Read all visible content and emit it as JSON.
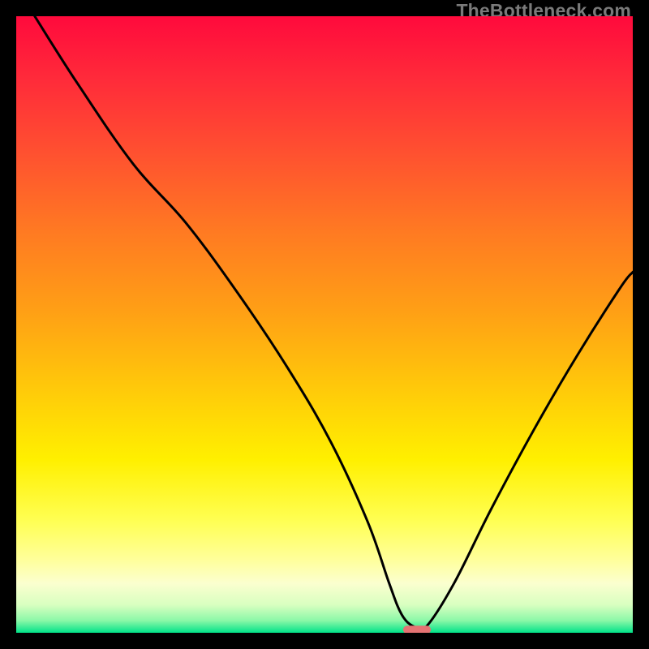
{
  "watermark": "TheBottleneck.com",
  "chart_data": {
    "type": "line",
    "title": "",
    "xlabel": "",
    "ylabel": "",
    "xlim": [
      0,
      100
    ],
    "ylim": [
      0,
      100
    ],
    "grid": false,
    "legend": false,
    "gradient_stops": [
      {
        "pos": 0.0,
        "color": "#ff0a3c"
      },
      {
        "pos": 0.1,
        "color": "#ff2a3a"
      },
      {
        "pos": 0.22,
        "color": "#ff5030"
      },
      {
        "pos": 0.35,
        "color": "#ff7a22"
      },
      {
        "pos": 0.48,
        "color": "#ffa015"
      },
      {
        "pos": 0.6,
        "color": "#ffc80a"
      },
      {
        "pos": 0.72,
        "color": "#fff000"
      },
      {
        "pos": 0.82,
        "color": "#ffff55"
      },
      {
        "pos": 0.88,
        "color": "#ffff99"
      },
      {
        "pos": 0.92,
        "color": "#fbffcf"
      },
      {
        "pos": 0.955,
        "color": "#d8ffc0"
      },
      {
        "pos": 0.98,
        "color": "#8cf8a8"
      },
      {
        "pos": 1.0,
        "color": "#00e288"
      }
    ],
    "series": [
      {
        "name": "bottleneck-curve",
        "x": [
          3.0,
          10.0,
          19.0,
          27.5,
          36.0,
          44.0,
          51.0,
          57.0,
          60.5,
          62.5,
          64.5,
          66.5,
          71.0,
          77.0,
          84.0,
          91.0,
          98.0,
          100.0
        ],
        "y": [
          100.0,
          89.0,
          76.0,
          66.5,
          55.0,
          43.0,
          31.0,
          18.0,
          8.0,
          3.0,
          1.0,
          1.0,
          8.0,
          20.0,
          33.0,
          45.0,
          56.0,
          58.5
        ]
      }
    ],
    "marker": {
      "name": "optimal-point",
      "x": 65.0,
      "y": 0.5,
      "width": 4.5,
      "height": 1.3,
      "color": "#e57373"
    }
  }
}
